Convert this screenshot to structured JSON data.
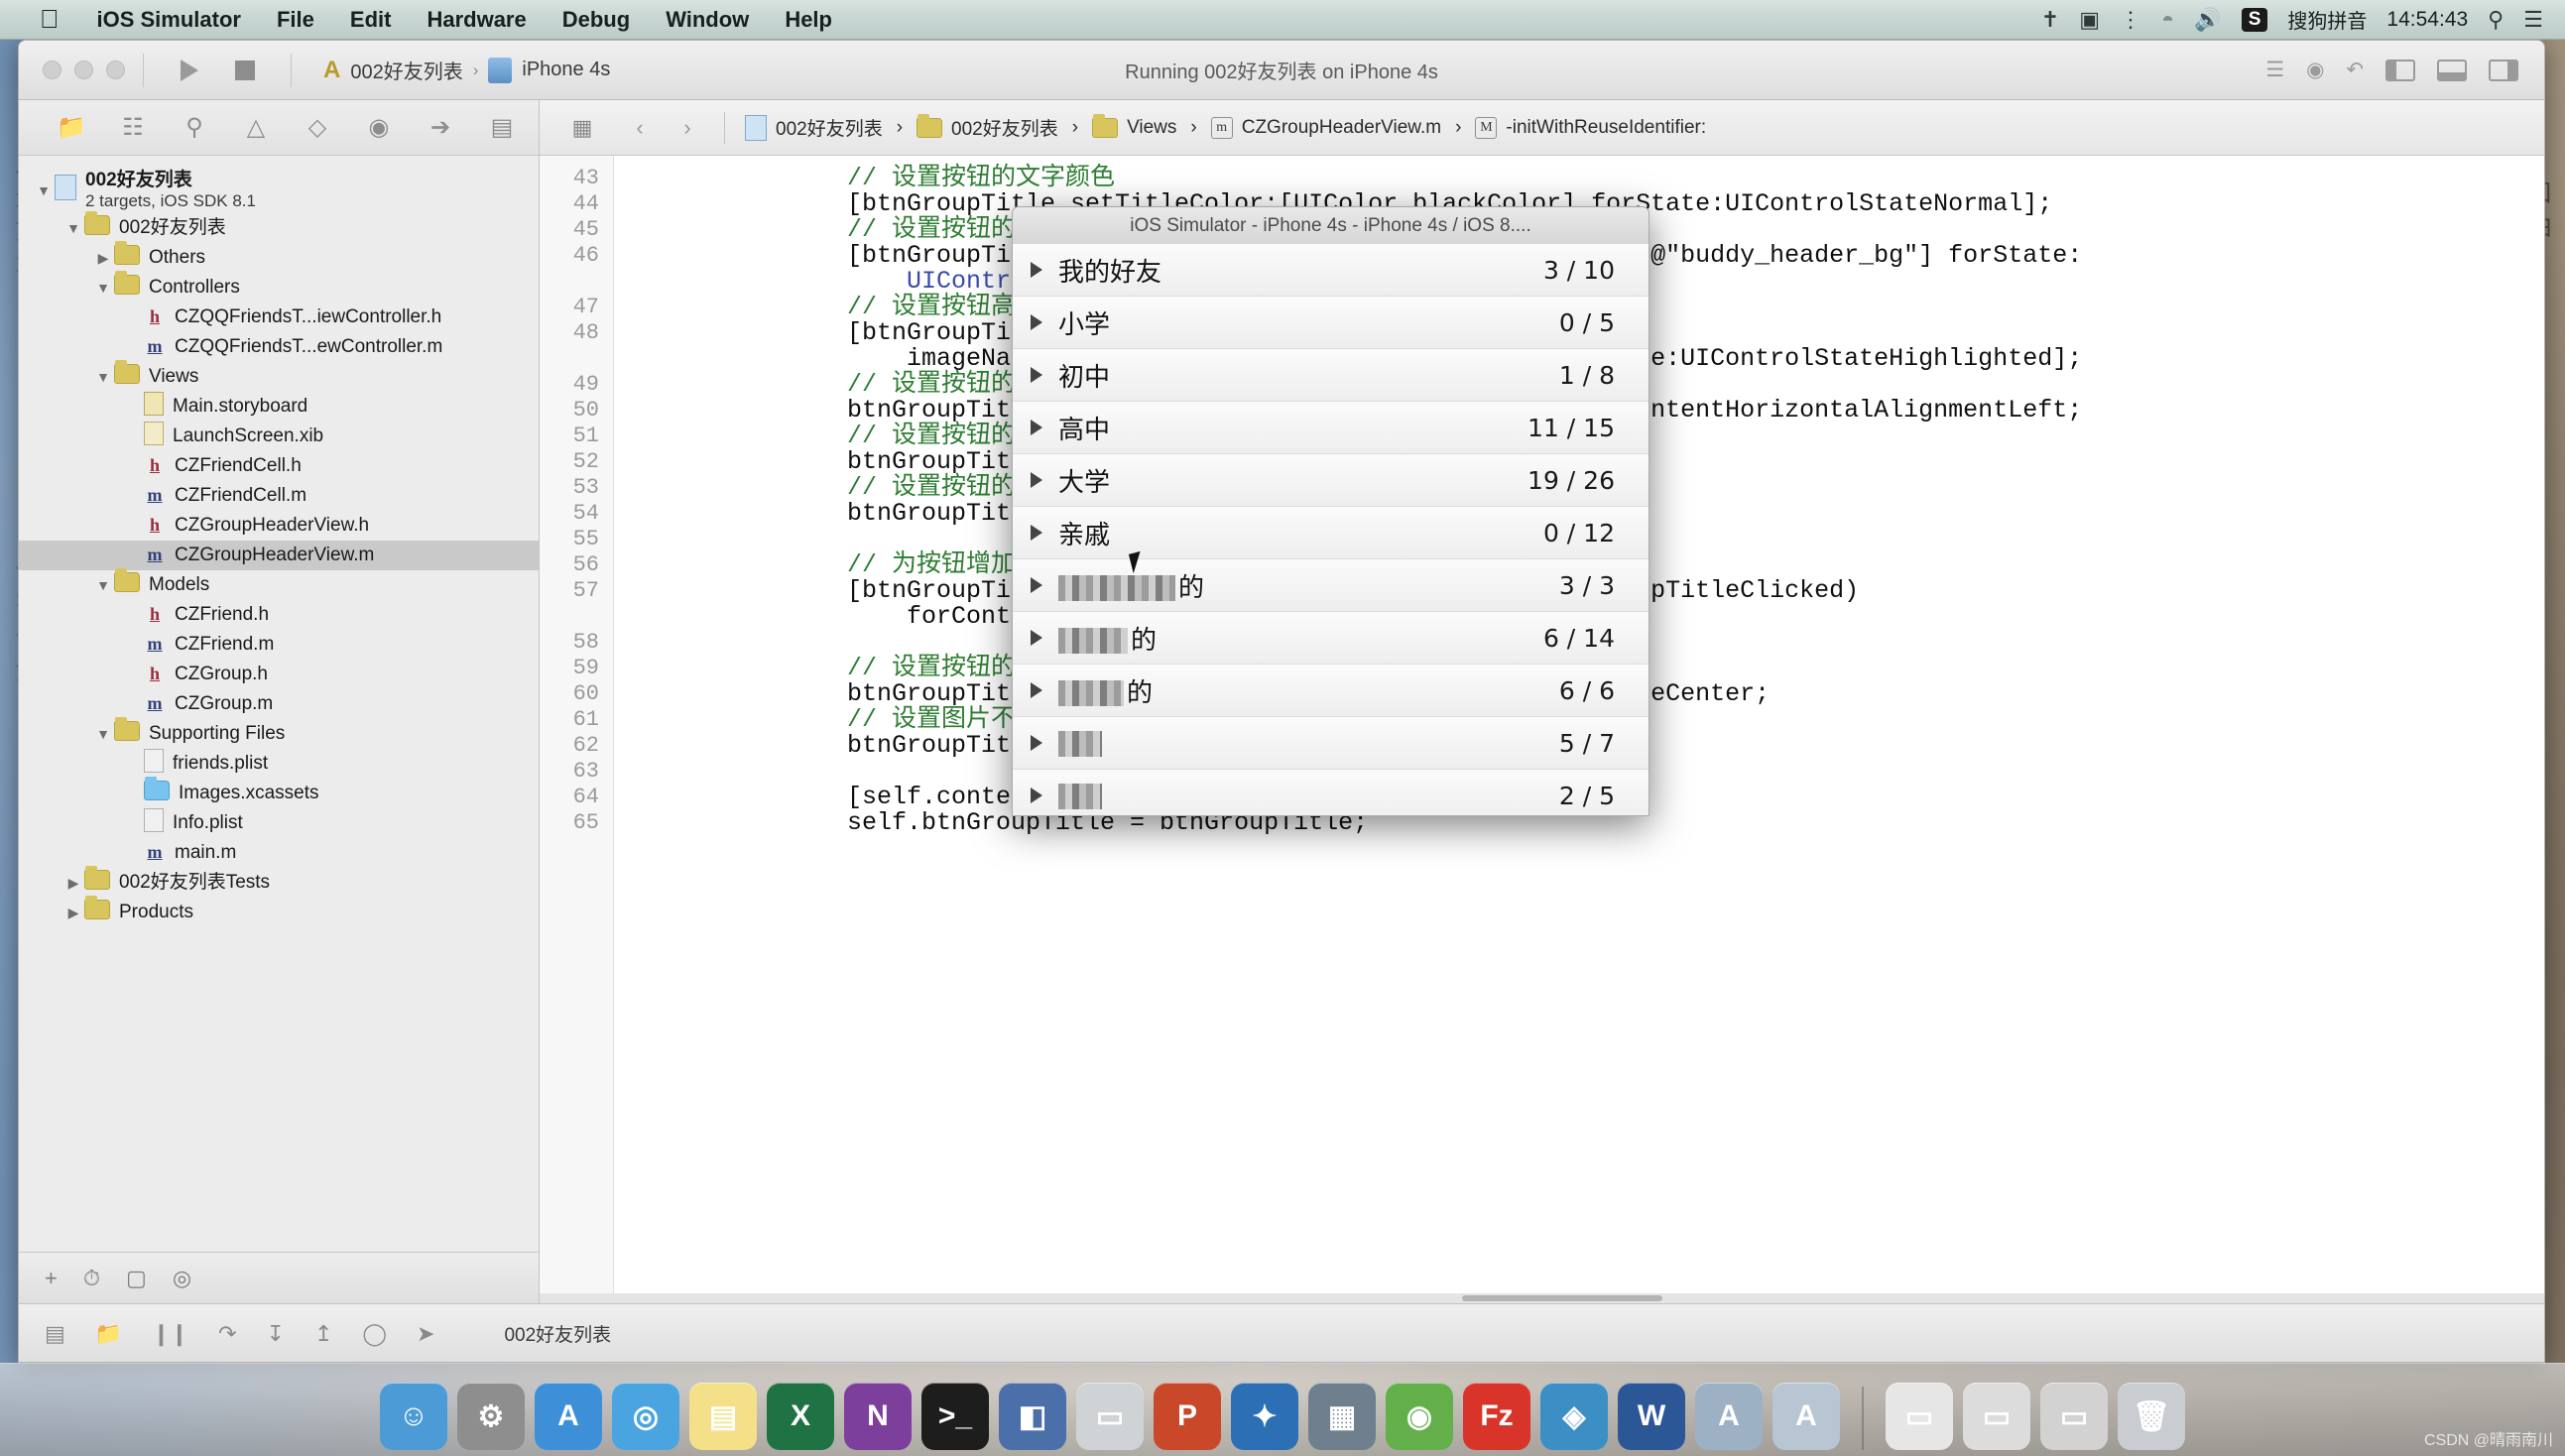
{
  "menubar": {
    "apple_icon": "apple-icon",
    "items": [
      "iOS Simulator",
      "File",
      "Edit",
      "Hardware",
      "Debug",
      "Window",
      "Help"
    ],
    "status_icons": [
      "bluetooth-icon",
      "screen-record-icon",
      "airplay-icon",
      "wifi-icon",
      "volume-icon"
    ],
    "ime_badge": "S",
    "ime_label": "搜狗拼音",
    "clock": "14:54:43",
    "search_icon": "search-icon",
    "notification_icon": "notification-center-icon"
  },
  "xcode": {
    "toolbar": {
      "run_icon": "run-icon",
      "stop_icon": "stop-icon",
      "scheme_project": "002好友列表",
      "scheme_sep": "›",
      "scheme_device": "iPhone 4s",
      "status": "Running 002好友列表 on iPhone 4s",
      "editor_icons": [
        "standard-editor-icon",
        "assistant-editor-icon",
        "version-editor-icon"
      ],
      "pane_icons": [
        "left-pane-toggle",
        "bottom-pane-toggle",
        "right-pane-toggle"
      ]
    },
    "navigator": {
      "tabs": [
        "folder-icon",
        "source-control-icon",
        "search-icon",
        "warning-icon",
        "test-icon",
        "debug-icon",
        "breakpoint-icon",
        "report-icon"
      ],
      "active_tab_index": 0,
      "tree": [
        {
          "indent": 0,
          "tw": "▼",
          "icon": "project-icon",
          "label": "002好友列表",
          "sub": "2 targets, iOS SDK 8.1",
          "bold": true
        },
        {
          "indent": 1,
          "tw": "▼",
          "icon": "folder",
          "label": "002好友列表"
        },
        {
          "indent": 2,
          "tw": "▶",
          "icon": "folder",
          "label": "Others"
        },
        {
          "indent": 2,
          "tw": "▼",
          "icon": "folder",
          "label": "Controllers"
        },
        {
          "indent": 3,
          "tw": "",
          "icon": "h",
          "label": "CZQQFriendsT...iewController.h"
        },
        {
          "indent": 3,
          "tw": "",
          "icon": "m",
          "label": "CZQQFriendsT...ewController.m"
        },
        {
          "indent": 2,
          "tw": "▼",
          "icon": "folder",
          "label": "Views"
        },
        {
          "indent": 3,
          "tw": "",
          "icon": "storyboard",
          "label": "Main.storyboard"
        },
        {
          "indent": 3,
          "tw": "",
          "icon": "xib",
          "label": "LaunchScreen.xib"
        },
        {
          "indent": 3,
          "tw": "",
          "icon": "h",
          "label": "CZFriendCell.h"
        },
        {
          "indent": 3,
          "tw": "",
          "icon": "m",
          "label": "CZFriendCell.m"
        },
        {
          "indent": 3,
          "tw": "",
          "icon": "h",
          "label": "CZGroupHeaderView.h"
        },
        {
          "indent": 3,
          "tw": "",
          "icon": "m",
          "label": "CZGroupHeaderView.m",
          "selected": true
        },
        {
          "indent": 2,
          "tw": "▼",
          "icon": "folder",
          "label": "Models"
        },
        {
          "indent": 3,
          "tw": "",
          "icon": "h",
          "label": "CZFriend.h"
        },
        {
          "indent": 3,
          "tw": "",
          "icon": "m",
          "label": "CZFriend.m"
        },
        {
          "indent": 3,
          "tw": "",
          "icon": "h",
          "label": "CZGroup.h"
        },
        {
          "indent": 3,
          "tw": "",
          "icon": "m",
          "label": "CZGroup.m"
        },
        {
          "indent": 2,
          "tw": "▼",
          "icon": "folder",
          "label": "Supporting Files"
        },
        {
          "indent": 3,
          "tw": "",
          "icon": "plist",
          "label": "friends.plist"
        },
        {
          "indent": 3,
          "tw": "",
          "icon": "folder-blue",
          "label": "Images.xcassets"
        },
        {
          "indent": 3,
          "tw": "",
          "icon": "plist",
          "label": "Info.plist"
        },
        {
          "indent": 3,
          "tw": "",
          "icon": "m",
          "label": "main.m"
        },
        {
          "indent": 1,
          "tw": "▶",
          "icon": "folder",
          "label": "002好友列表Tests"
        },
        {
          "indent": 1,
          "tw": "▶",
          "icon": "folder",
          "label": "Products"
        }
      ],
      "footer_icons": [
        "add-icon",
        "recent-icon",
        "filter-icon",
        "status-icon"
      ]
    },
    "jumpbar": {
      "back_icon": "back-chevron-icon",
      "forward_icon": "forward-chevron-icon",
      "related_icon": "related-files-icon",
      "crumbs": [
        "002好友列表",
        "002好友列表",
        "Views",
        "CZGroupHeaderView.m",
        "-initWithReuseIdentifier:"
      ]
    },
    "code": {
      "line_numbers": [
        "43",
        "44",
        "45",
        "46",
        "",
        "47",
        "48",
        "",
        "49",
        "50",
        "51",
        "52",
        "53",
        "54",
        "55",
        "56",
        "57",
        "",
        "58",
        "59",
        "60",
        "61",
        "62",
        "63",
        "64",
        "65",
        ""
      ],
      "lines": [
        {
          "n": "43",
          "segs": [
            {
              "t": "// 设置按钮的文字颜色",
              "c": "c-cm"
            }
          ]
        },
        {
          "n": "44",
          "segs": [
            {
              "t": "[btnGroupTitle setTitleColor:[UIColor blackColor] forState:UIControlStateNormal];",
              "c": ""
            }
          ]
        },
        {
          "n": "45",
          "segs": [
            {
              "t": "// 设置按钮的背景图片",
              "c": "c-cm"
            }
          ]
        },
        {
          "n": "46",
          "segs": [
            {
              "t": "[btnGroupTitle setBackgroundImage:[UIImage imageNamed:@\"buddy_header_bg\"] forState:",
              "c": ""
            }
          ]
        },
        {
          "n": "",
          "segs": [
            {
              "t": "    UIControlStateNormal];",
              "c": "c-ty"
            }
          ]
        },
        {
          "n": "47",
          "segs": [
            {
              "t": "// 设置按钮高亮的背景图片",
              "c": "c-cm"
            }
          ]
        },
        {
          "n": "48",
          "segs": [
            {
              "t": "[btnGroupTitle setBackgroundImage:[UIImage",
              "c": ""
            }
          ]
        },
        {
          "n": "",
          "segs": [
            {
              "t": "    imageNamed:@\"buddy_header_bg_highlighted\"] forState:UIControlStateHighlighted];",
              "c": ""
            }
          ]
        },
        {
          "n": "49",
          "segs": [
            {
              "t": "// 设置按钮的水平对齐方式",
              "c": "c-cm"
            }
          ]
        },
        {
          "n": "50",
          "segs": [
            {
              "t": "btnGroupTitle.contentHorizontalAlignment = UIControlContentHorizontalAlignmentLeft;",
              "c": ""
            }
          ]
        },
        {
          "n": "51",
          "segs": [
            {
              "t": "// 设置按钮的内容边距",
              "c": "c-cm"
            }
          ]
        },
        {
          "n": "52",
          "segs": [
            {
              "t": "btnGroupTitle.contentEdgeInsetsMake(0, 10, 0, 0);",
              "c": ""
            }
          ]
        },
        {
          "n": "53",
          "segs": [
            {
              "t": "// 设置按钮的图片边距",
              "c": "c-cm"
            }
          ]
        },
        {
          "n": "54",
          "segs": [
            {
              "t": "btnGroupTitle.imageEdgeInsetsMake(0, 5, 0, 0);",
              "c": ""
            }
          ]
        },
        {
          "n": "55",
          "segs": [
            {
              "t": "",
              "c": ""
            }
          ]
        },
        {
          "n": "56",
          "segs": [
            {
              "t": "// 为按钮增加监听方法",
              "c": "c-cm"
            }
          ]
        },
        {
          "n": "57",
          "segs": [
            {
              "t": "[btnGroupTitle addTarget:self action:@selector(btnGroupTitleClicked)",
              "c": ""
            }
          ]
        },
        {
          "n": "",
          "segs": [
            {
              "t": "    forControlEvents:UIControlEventTouchUpInside];",
              "c": ""
            }
          ]
        },
        {
          "n": "58",
          "segs": [
            {
              "t": "",
              "c": ""
            }
          ]
        },
        {
          "n": "59",
          "segs": [
            {
              "t": "// 设置按钮的图片内容模式",
              "c": "c-cm"
            }
          ]
        },
        {
          "n": "60",
          "segs": [
            {
              "t": "btnGroupTitle.imageView.contentMode = UIViewContentModeCenter;",
              "c": ""
            }
          ]
        },
        {
          "n": "61",
          "segs": [
            {
              "t": "// 设置图片不裁剪",
              "c": "c-cm"
            }
          ]
        },
        {
          "n": "62",
          "segs": [
            {
              "t": "btnGroupTitle.imageView.clipsToBounds = NO;",
              "c": ""
            }
          ]
        },
        {
          "n": "63",
          "segs": [
            {
              "t": "",
              "c": ""
            }
          ]
        },
        {
          "n": "64",
          "segs": [
            {
              "t": "[self.contentView addSubview:btnGroupTitle];",
              "c": ""
            }
          ]
        },
        {
          "n": "65",
          "segs": [
            {
              "t": "self.btnGroupTitle = btnGroupTitle;",
              "c": ""
            }
          ]
        }
      ]
    },
    "footbar": {
      "icons": [
        "hide-debug-icon",
        "folder-icon",
        "pause-icon",
        "step-over-icon",
        "step-into-icon",
        "step-out-icon",
        "stack-icon",
        "location-icon"
      ],
      "label": "002好友列表"
    }
  },
  "simulator": {
    "title": "iOS Simulator - iPhone 4s - iPhone 4s / iOS 8....",
    "groups": [
      {
        "name": "我的好友",
        "count": "3 / 10",
        "redacted": false
      },
      {
        "name": "小学",
        "count": "0 / 5",
        "redacted": false
      },
      {
        "name": "初中",
        "count": "1 / 8",
        "redacted": false
      },
      {
        "name": "高中",
        "count": "11 / 15",
        "redacted": false
      },
      {
        "name": "大学",
        "count": "19 / 26",
        "redacted": false
      },
      {
        "name": "亲戚",
        "count": "0 / 12",
        "redacted": false
      },
      {
        "name": "的",
        "count": "3 / 3",
        "redacted": true,
        "redact_width": 118
      },
      {
        "name": "的",
        "count": "6 / 14",
        "redacted": true,
        "redact_width": 70
      },
      {
        "name": "的",
        "count": "6 / 6",
        "redacted": true,
        "redact_width": 66
      },
      {
        "name": "",
        "count": "5 / 7",
        "redacted": true,
        "redact_width": 44
      },
      {
        "name": "",
        "count": "2 / 5",
        "redacted": true,
        "redact_width": 44
      }
    ]
  },
  "dock": {
    "items": [
      {
        "name": "finder-icon",
        "color": "#4d9bd6",
        "glyph": "☺"
      },
      {
        "name": "system-preferences-icon",
        "color": "#8e8e8e",
        "glyph": "⚙"
      },
      {
        "name": "app-store-icon",
        "color": "#3d8fd8",
        "glyph": "A"
      },
      {
        "name": "safari-icon",
        "color": "#4aa4e0",
        "glyph": "◎"
      },
      {
        "name": "notes-icon",
        "color": "#f5e08a",
        "glyph": "▤"
      },
      {
        "name": "excel-icon",
        "color": "#1f7244",
        "glyph": "X"
      },
      {
        "name": "onenote-icon",
        "color": "#7d3f9c",
        "glyph": "N"
      },
      {
        "name": "terminal-icon",
        "color": "#1d1d1d",
        "glyph": ">_"
      },
      {
        "name": "preview-icon",
        "color": "#4b6fa8",
        "glyph": "◧"
      },
      {
        "name": "simulator-icon",
        "color": "#cfd3d6",
        "glyph": "▭"
      },
      {
        "name": "powerpoint-icon",
        "color": "#c9482a",
        "glyph": "P"
      },
      {
        "name": "xcode-icon",
        "color": "#2d6fb5",
        "glyph": "✦"
      },
      {
        "name": "remote-desktop-icon",
        "color": "#6f7f8e",
        "glyph": "▦"
      },
      {
        "name": "mail-icon",
        "color": "#63b04b",
        "glyph": "◉"
      },
      {
        "name": "filezilla-icon",
        "color": "#d8342a",
        "glyph": "Fz"
      },
      {
        "name": "charles-icon",
        "color": "#3b8fc4",
        "glyph": "◈"
      },
      {
        "name": "word-icon",
        "color": "#2b5797",
        "glyph": "W"
      },
      {
        "name": "appstore2-icon",
        "color": "#9cb1c4",
        "glyph": "A"
      },
      {
        "name": "appstore3-icon",
        "color": "#b8c5d2",
        "glyph": "A"
      },
      {
        "name": "window1-icon",
        "color": "#e6e6e6",
        "glyph": "▭"
      },
      {
        "name": "window2-icon",
        "color": "#dcdcdc",
        "glyph": "▭"
      },
      {
        "name": "window3-icon",
        "color": "#d2d2d2",
        "glyph": "▭"
      },
      {
        "name": "trash-icon",
        "color": "#c9cdd1",
        "glyph": "🗑"
      }
    ]
  },
  "watermark": "CSDN @晴雨南川"
}
